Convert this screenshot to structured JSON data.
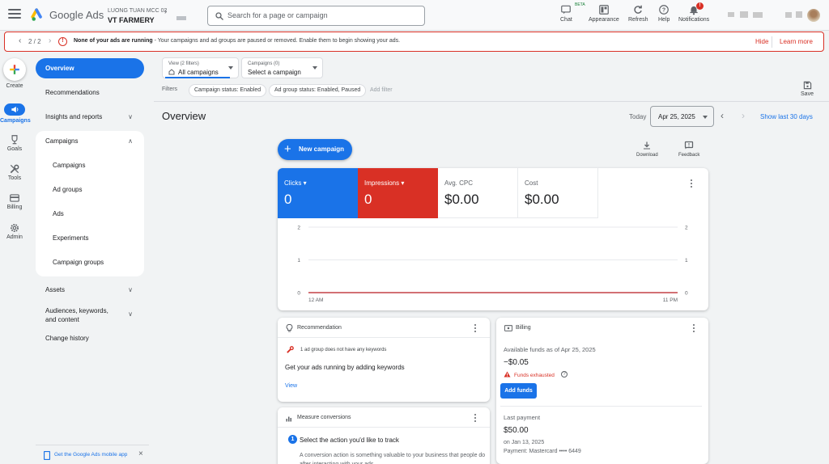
{
  "header": {
    "product": "Google Ads",
    "account_sub": "LUONG TUAN MCC 02",
    "account_name": "VT FARMERY",
    "search_placeholder": "Search for a page or campaign",
    "tools": [
      {
        "label": "Chat",
        "icon": "chat-icon"
      },
      {
        "label": "Appearance",
        "icon": "appearance-icon"
      },
      {
        "label": "Refresh",
        "icon": "refresh-icon"
      },
      {
        "label": "Help",
        "icon": "help-icon"
      },
      {
        "label": "Notifications",
        "icon": "bell-icon"
      }
    ],
    "beta_tag": "BETA",
    "notification_count": "!"
  },
  "alert": {
    "counter": "2 / 2",
    "title": "None of your ads are running",
    "message": " - Your campaigns and ad groups are paused or removed. Enable them to begin showing your ads.",
    "hide": "Hide",
    "learn_more": "Learn more",
    "icon_char": "!"
  },
  "rail": {
    "create": "Create",
    "items": [
      {
        "label": "Campaigns",
        "icon": "megaphone-icon"
      },
      {
        "label": "Goals",
        "icon": "trophy-icon"
      },
      {
        "label": "Tools",
        "icon": "tools-icon"
      },
      {
        "label": "Billing",
        "icon": "credit-card-icon"
      },
      {
        "label": "Admin",
        "icon": "gear-icon"
      }
    ]
  },
  "nav": {
    "overview": "Overview",
    "recommendations": "Recommendations",
    "insights": "Insights and reports",
    "campaigns": "Campaigns",
    "sub": [
      "Campaigns",
      "Ad groups",
      "Ads",
      "Experiments",
      "Campaign groups"
    ],
    "assets": "Assets",
    "audiences": "Audiences, keywords, and content",
    "change_history": "Change history",
    "mobile_app": "Get the Google Ads mobile app"
  },
  "filters": {
    "view_top": "View (2 filters)",
    "view_main": "All campaigns",
    "campaigns_top": "Campaigns (0)",
    "campaigns_main": "Select a campaign",
    "label": "Filters",
    "chips": [
      "Campaign status: Enabled",
      "Ad group status: Enabled, Paused"
    ],
    "add_filter": "Add filter",
    "save": "Save"
  },
  "overview": {
    "title": "Overview",
    "today": "Today",
    "date": "Apr 25, 2025",
    "show_last": "Show last 30 days",
    "new_campaign": "New campaign",
    "download": "Download",
    "feedback": "Feedback"
  },
  "metrics": [
    {
      "label": "Clicks",
      "value": "0",
      "color": "#1a73e8"
    },
    {
      "label": "Impressions",
      "value": "0",
      "color": "#d93025"
    },
    {
      "label": "Avg. CPC",
      "value": "$0.00"
    },
    {
      "label": "Cost",
      "value": "$0.00"
    }
  ],
  "chart_data": {
    "type": "line",
    "x": [
      "12 AM",
      "11 PM"
    ],
    "series": [
      {
        "name": "Clicks",
        "values": [
          0,
          0
        ],
        "color": "#1a73e8"
      },
      {
        "name": "Impressions",
        "values": [
          0,
          0
        ],
        "color": "#d93025"
      }
    ],
    "ylim": [
      0,
      2
    ],
    "y_ticks": [
      "0",
      "1",
      "2"
    ],
    "x_ticks": [
      "12 AM",
      "11 PM"
    ],
    "grid": true
  },
  "recommendation": {
    "title": "Recommendation",
    "item": "1 ad group does not have any keywords",
    "headline": "Get your ads running by adding keywords",
    "view": "View"
  },
  "billing": {
    "title": "Billing",
    "funds_label": "Available funds as of Apr 25, 2025",
    "funds_value": "−$0.05",
    "warning": "Funds exhausted",
    "add_funds": "Add funds",
    "last_payment_label": "Last payment",
    "last_payment_value": "$50.00",
    "last_payment_date": "on Jan 13, 2025",
    "payment_method": "Payment: Mastercard •••• 6449"
  },
  "conversions": {
    "title": "Measure conversions",
    "step": "1",
    "step_title": "Select the action you'd like to track",
    "step_text": "A conversion action is something valuable to your business that people do after interacting with your ads."
  }
}
